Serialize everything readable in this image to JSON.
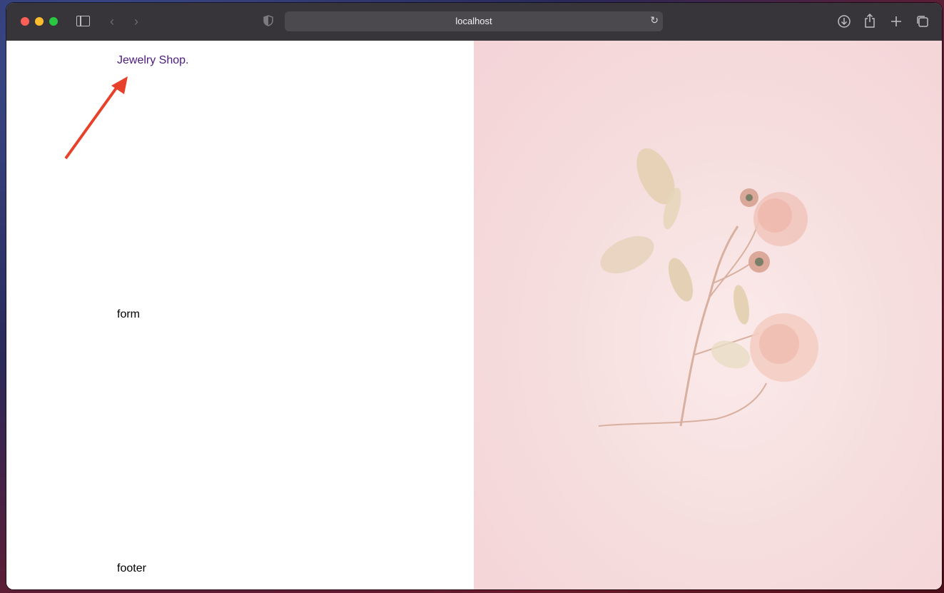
{
  "browser": {
    "url": "localhost",
    "icons": {
      "sidebar": "sidebar-icon",
      "back": "chevron-left-icon",
      "forward": "chevron-right-icon",
      "privacy": "shield-icon",
      "reload": "reload-icon",
      "download": "download-icon",
      "share": "share-icon",
      "new_tab": "plus-icon",
      "tabs": "tabs-overview-icon"
    }
  },
  "page": {
    "logo": "Jewelry Shop.",
    "form_placeholder": "form",
    "footer_placeholder": "footer"
  },
  "colors": {
    "logo": "#4a1a80",
    "annotation_arrow": "#e8412a",
    "hero_background": "#f6dede"
  }
}
